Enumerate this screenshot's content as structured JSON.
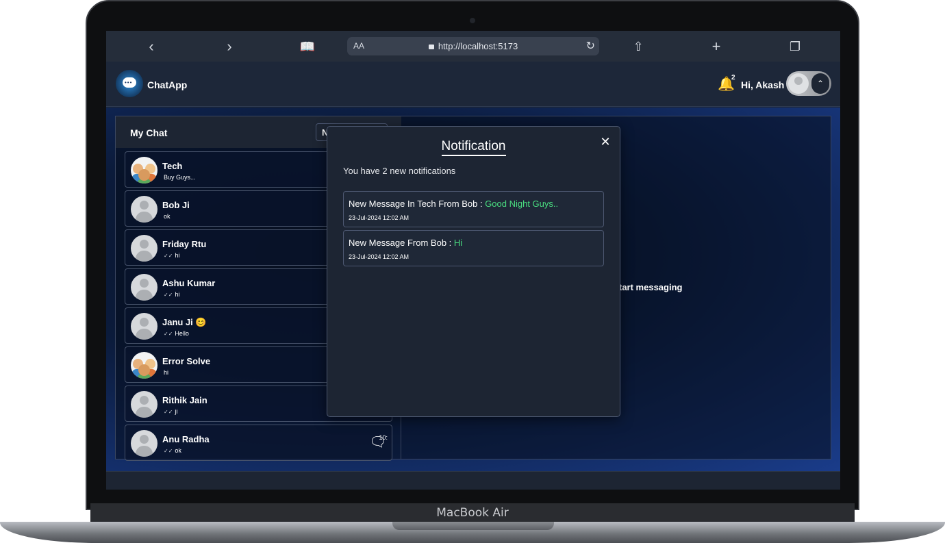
{
  "device": {
    "label": "MacBook Air"
  },
  "browser": {
    "aa_label": "AA",
    "url": "http://localhost:5173"
  },
  "app": {
    "title": "ChatApp",
    "notification_count": "2",
    "greeting": "Hi, Akash"
  },
  "chat_panel": {
    "title": "My Chat",
    "new_group_label": "New Group",
    "chats": [
      {
        "name": "Tech",
        "message": "Buy Guys...",
        "time": "",
        "ticks": false,
        "avatar": "group"
      },
      {
        "name": "Bob Ji",
        "message": "ok",
        "time": "",
        "ticks": false,
        "avatar": "person"
      },
      {
        "name": "Friday Rtu",
        "message": "hi",
        "time": "",
        "ticks": true,
        "avatar": "person"
      },
      {
        "name": "Ashu Kumar",
        "message": "hi",
        "time": "",
        "ticks": true,
        "avatar": "person"
      },
      {
        "name": "Janu Ji 😊",
        "message": "Hello",
        "time": "",
        "ticks": true,
        "avatar": "person"
      },
      {
        "name": "Error Solve",
        "message": "hi",
        "time": "",
        "ticks": false,
        "avatar": "group"
      },
      {
        "name": "Rithik Jain",
        "message": "ji",
        "time": "",
        "ticks": true,
        "avatar": "person"
      },
      {
        "name": "Anu Radha",
        "message": "ok",
        "time": "10:",
        "ticks": true,
        "avatar": "person"
      }
    ]
  },
  "main_area": {
    "placeholder_text": "tart messaging"
  },
  "notification_modal": {
    "title": "Notification",
    "summary": "You have 2 new notifications",
    "items": [
      {
        "prefix": "New Message In Tech From Bob : ",
        "message": "Good Night Guys..",
        "time": "23-Jul-2024 12:02 AM"
      },
      {
        "prefix": "New Message From Bob : ",
        "message": "Hi",
        "time": "23-Jul-2024 12:02 AM"
      }
    ]
  },
  "colors": {
    "highlight_green": "#4ade80",
    "panel_bg": "#1d2533"
  }
}
